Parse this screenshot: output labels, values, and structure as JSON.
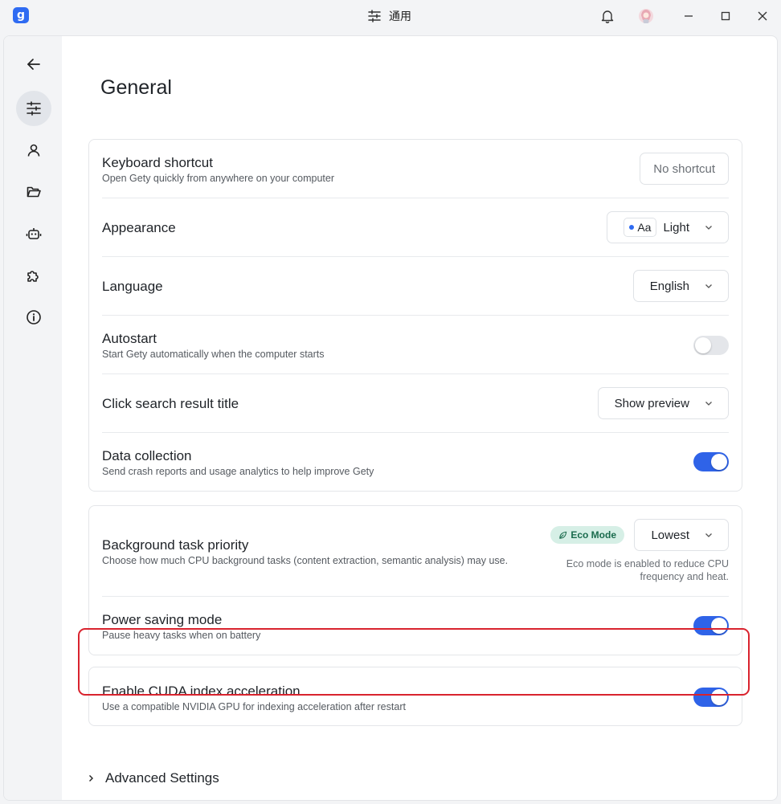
{
  "titlebar": {
    "app_logo_glyph": "g",
    "title": "通用",
    "icons": [
      "sliders-icon",
      "bell-icon",
      "avatar",
      "minimize-icon",
      "maximize-icon",
      "close-icon"
    ]
  },
  "sidebar": {
    "items": [
      {
        "name": "back-icon"
      },
      {
        "name": "sliders-icon",
        "active": true
      },
      {
        "name": "user-icon"
      },
      {
        "name": "folder-icon"
      },
      {
        "name": "robot-icon"
      },
      {
        "name": "puzzle-icon"
      },
      {
        "name": "info-icon"
      }
    ]
  },
  "page": {
    "title": "General"
  },
  "general_card": {
    "keyboard_shortcut": {
      "title": "Keyboard shortcut",
      "desc": "Open Gety quickly from anywhere on your computer",
      "button": "No shortcut"
    },
    "appearance": {
      "title": "Appearance",
      "badge": "Aa",
      "value": "Light"
    },
    "language": {
      "title": "Language",
      "value": "English"
    },
    "autostart": {
      "title": "Autostart",
      "desc": "Start Gety automatically when the computer starts",
      "enabled": false
    },
    "click_search": {
      "title": "Click search result title",
      "value": "Show preview"
    },
    "data_collection": {
      "title": "Data collection",
      "desc": "Send crash reports and usage analytics to help improve Gety",
      "enabled": true
    }
  },
  "performance_card": {
    "background_priority": {
      "title": "Background task priority",
      "desc": "Choose how much CPU background tasks (content extraction, semantic analysis) may use.",
      "eco_badge": "Eco Mode",
      "value": "Lowest",
      "note_line1": "Eco mode is enabled to reduce CPU",
      "note_line2": "frequency and heat."
    },
    "power_saving": {
      "title": "Power saving mode",
      "desc": "Pause heavy tasks when on battery",
      "enabled": true
    }
  },
  "cuda_card": {
    "title": "Enable CUDA index acceleration",
    "desc": "Use a compatible NVIDIA GPU for indexing acceleration after restart",
    "enabled": true
  },
  "advanced": {
    "label": "Advanced Settings"
  },
  "colors": {
    "accent": "#2f63e8",
    "highlight_border": "#d9232e",
    "eco_bg": "#d6efe6",
    "eco_text": "#1a6b4d"
  }
}
